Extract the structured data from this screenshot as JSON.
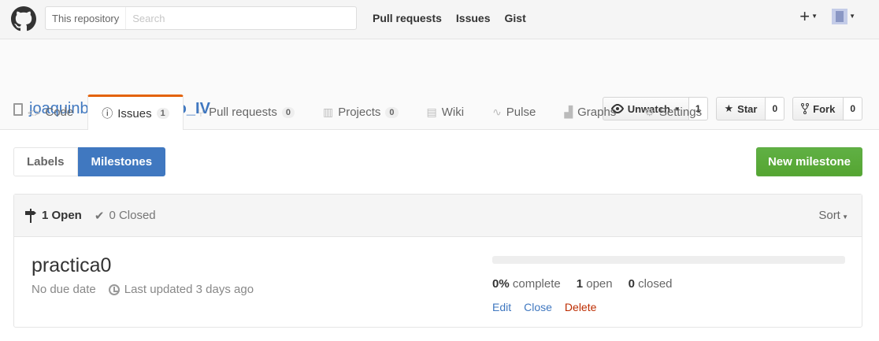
{
  "header": {
    "search_scope": "This repository",
    "search_placeholder": "Search",
    "nav": [
      "Pull requests",
      "Issues",
      "Gist"
    ],
    "new_icon": "plus-icon",
    "avatar": "avatar-image"
  },
  "repo": {
    "owner": "joaquinb25",
    "separator": "/",
    "name": "proyecto_IV",
    "watch": {
      "label": "Unwatch",
      "count": "1"
    },
    "star": {
      "label": "Star",
      "count": "0"
    },
    "fork": {
      "label": "Fork",
      "count": "0"
    }
  },
  "tabs": [
    {
      "label": "Code",
      "icon": "code-icon"
    },
    {
      "label": "Issues",
      "icon": "issue-icon",
      "counter": "1"
    },
    {
      "label": "Pull requests",
      "icon": "pull-request-icon",
      "counter": "0"
    },
    {
      "label": "Projects",
      "icon": "project-icon",
      "counter": "0"
    },
    {
      "label": "Wiki",
      "icon": "book-icon"
    },
    {
      "label": "Pulse",
      "icon": "pulse-icon"
    },
    {
      "label": "Graphs",
      "icon": "graph-icon"
    },
    {
      "label": "Settings",
      "icon": "gear-icon"
    }
  ],
  "subnav": {
    "labels": "Labels",
    "milestones": "Milestones",
    "new_milestone": "New milestone"
  },
  "list": {
    "open": "1 Open",
    "closed": "0 Closed",
    "sort": "Sort"
  },
  "milestone": {
    "title": "practica0",
    "due": "No due date",
    "updated": "Last updated 3 days ago",
    "progress_fraction": 0,
    "percent": "0%",
    "complete": "complete",
    "open_count": "1",
    "open_label": "open",
    "closed_count": "0",
    "closed_label": "closed",
    "edit": "Edit",
    "close": "Close",
    "delete": "Delete"
  },
  "colors": {
    "link": "#4078c0",
    "selected_tab_border": "#e36209",
    "primary_button": "#55a532",
    "danger": "#bd2c00"
  }
}
